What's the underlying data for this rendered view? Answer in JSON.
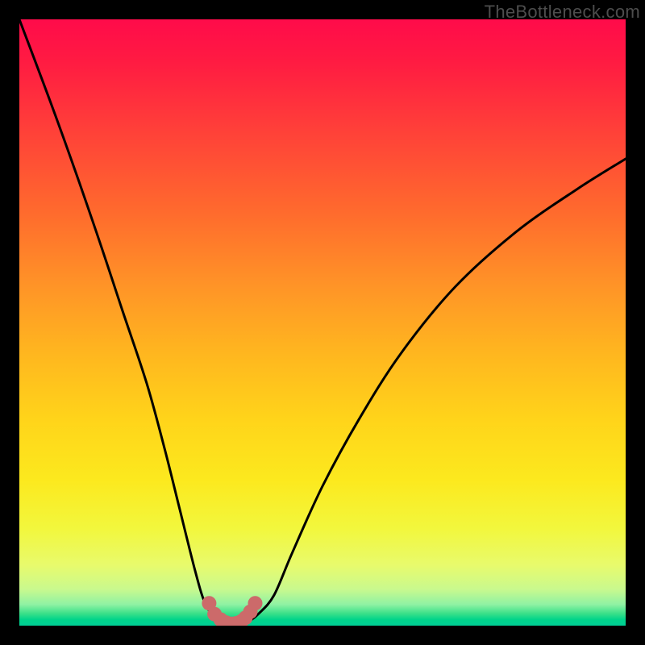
{
  "watermark": "TheBottleneck.com",
  "chart_data": {
    "type": "line",
    "title": "",
    "xlabel": "",
    "ylabel": "",
    "xlim": [
      0,
      100
    ],
    "ylim": [
      0,
      100
    ],
    "series": [
      {
        "name": "bottleneck-curve",
        "x": [
          0,
          6,
          12,
          17,
          21,
          24,
          26.5,
          29,
          30.5,
          32,
          33,
          35,
          36.5,
          38,
          39.5,
          42,
          45,
          50,
          56,
          63,
          72,
          82,
          92,
          100
        ],
        "y": [
          100,
          84,
          67,
          52,
          40,
          29,
          19,
          9,
          4,
          1.5,
          0.5,
          0,
          0,
          0.8,
          2,
          5,
          12,
          23,
          34,
          45,
          56,
          65,
          72,
          77
        ]
      },
      {
        "name": "highlight-dots",
        "x": [
          31.3,
          32.2,
          33.2,
          34.1,
          35.0,
          35.8,
          36.6,
          37.3,
          38.1,
          38.9
        ],
        "y": [
          3.7,
          1.9,
          1.0,
          0.5,
          0.3,
          0.4,
          0.7,
          1.3,
          2.3,
          3.7
        ]
      }
    ],
    "colors": {
      "curve": "#000000",
      "dots": "#cc6a6a"
    }
  }
}
